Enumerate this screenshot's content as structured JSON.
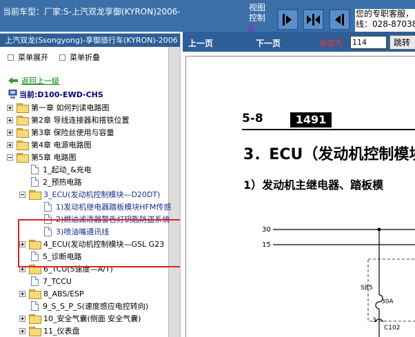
{
  "header": {
    "car_model": "当前车型：厂家:S-上汽双龙享御(KYRON)2006-",
    "view_control_label": "视图控制",
    "support_text": "您的专职客服，\n线：028-87038"
  },
  "sidebar": {
    "title": "上汽双龙(Ssongyong)-享御旅行车(KYRON)-2006",
    "expand_all": "菜单展开",
    "collapse_all": "菜单折叠",
    "back": "返回上一级",
    "current": "当前:D100-EWD-CHS",
    "tree": [
      {
        "label": "第一章 如何判读电路图"
      },
      {
        "label": "第2章 导线连接器和搭铁位置"
      },
      {
        "label": "第3章 保险丝使用与容量"
      },
      {
        "label": "第4章 电源电路图"
      },
      {
        "label": "第5章 电路图"
      },
      {
        "label": "1_起动_&充电"
      },
      {
        "label": "2_预热电路"
      },
      {
        "label": "3_ECU(发动机控制模块—D20DT)"
      },
      {
        "label": "1)发动机继电器踏板模块HFM传感"
      },
      {
        "label": "2)燃油滤清器警告灯钥匙防盗系统"
      },
      {
        "label": "3)喷油嘴通讯线"
      },
      {
        "label": "4_ECU(发动机控制模块—GSL G23"
      },
      {
        "label": "5_诊断电路"
      },
      {
        "label": "6_TCU(5速度—A/T)"
      },
      {
        "label": "7_TCCU"
      },
      {
        "label": "8_ABS/ESP"
      },
      {
        "label": "9_S_S_P_S(速度感应电控转向)"
      },
      {
        "label": "10_安全气囊(侧面 安全气囊)"
      },
      {
        "label": "11_仪表盘"
      }
    ]
  },
  "toolbar": {
    "prev": "上一页",
    "next": "下一页",
    "current_label": "当前为",
    "page_value": "114",
    "jump": "跳转"
  },
  "document": {
    "section": "5-8",
    "page_number": "1491",
    "heading": "3．ECU（发动机控制模块",
    "subheading": "1）发动机主继电器、踏板模",
    "diagram": {
      "line_a": "30",
      "line_b": "15",
      "fuse": "SB5",
      "fuse_rating": "30A",
      "connector_pin": "3",
      "connector": "C102"
    }
  },
  "colors": {
    "header_bg": "#3b6fa8",
    "title_bar": "#2d5e97",
    "highlight": "#e02020",
    "folder": "#f6d978"
  }
}
